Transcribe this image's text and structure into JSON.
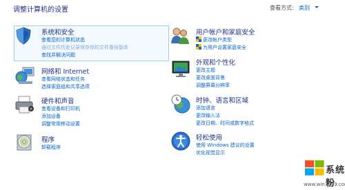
{
  "header": {
    "title": "调整计算机的设置",
    "view_by_label": "查看方式:",
    "view_by_value": "类别"
  },
  "categories": [
    {
      "title": "系统和安全",
      "links": [
        "查看您的计算机状态",
        "通过文件历史记录保存你的文件备份副本",
        "查找并解决问题"
      ],
      "icon": "shield-icon"
    },
    {
      "title": "网络和 Internet",
      "links": [
        "查看网络状态和任务",
        "选择家庭组和共享选项"
      ],
      "icon": "network-globe-icon"
    },
    {
      "title": "硬件和声音",
      "links": [
        "查看设备和打印机",
        "添加设备",
        "调整常用移动设置"
      ],
      "icon": "printer-icon"
    },
    {
      "title": "程序",
      "links": [
        "卸载程序"
      ],
      "icon": "programs-disc-icon"
    },
    {
      "title": "用户帐户和家庭安全",
      "links": [
        "更改帐户类型",
        "为用户设置家庭安全"
      ],
      "icon": "users-icon"
    },
    {
      "title": "外观和个性化",
      "links": [
        "更改主题",
        "更改桌面背景",
        "调整屏幕分辨率"
      ],
      "icon": "monitor-icon"
    },
    {
      "title": "时钟、语言和区域",
      "links": [
        "添加语言",
        "更改输入法",
        "更改日期、时间或数字格式"
      ],
      "icon": "clock-globe-icon"
    },
    {
      "title": "轻松使用",
      "links": [
        "使用 Windows 建议的设置",
        "优化视觉显示"
      ],
      "icon": "ease-of-access-icon"
    }
  ],
  "watermark": {
    "text": "系统粉",
    "url": "www.win7999.com",
    "colors": [
      "#f25022",
      "#7fba00",
      "#00a4ef",
      "#ffb900"
    ]
  }
}
